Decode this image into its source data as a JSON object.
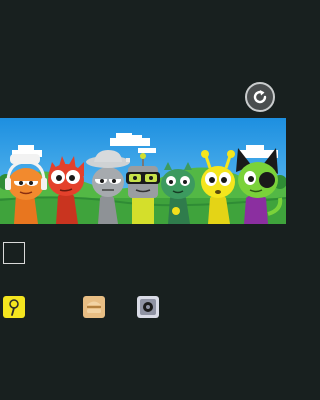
{
  "controls": {
    "reset_icon": "reset-icon",
    "drop_slot": "empty-slot",
    "tiles": [
      {
        "icon": "microphone-icon",
        "color": "#f4e51f"
      },
      {
        "icon": "burger-icon",
        "color": "#e8be84"
      },
      {
        "icon": "speaker-icon",
        "color": "#d9dbe6"
      }
    ]
  },
  "stage": {
    "characters": [
      {
        "name": "orange-headphones",
        "color": "#f28a2e"
      },
      {
        "name": "red-spiky",
        "color": "#e4412c"
      },
      {
        "name": "gray-hat",
        "color": "#a6aaae"
      },
      {
        "name": "green-goggles",
        "color": "#d4df2b"
      },
      {
        "name": "dark-green-antenna",
        "color": "#3c9a5f"
      },
      {
        "name": "yellow-antenna",
        "color": "#f5e61d"
      },
      {
        "name": "green-black-ears",
        "color": "#7ad23a"
      }
    ]
  }
}
